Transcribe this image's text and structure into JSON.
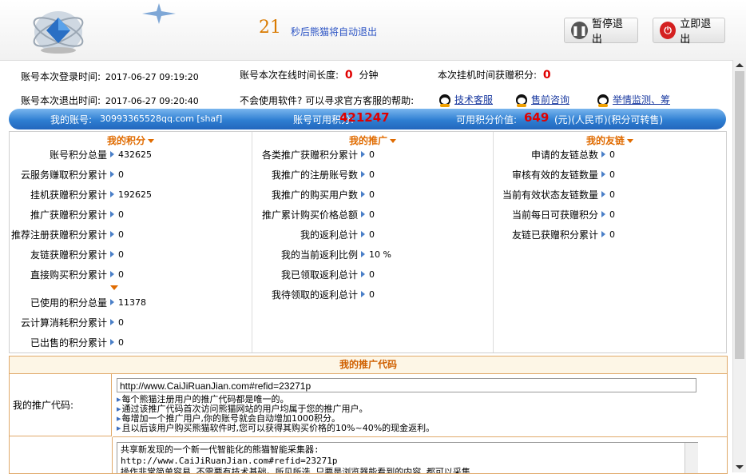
{
  "header": {
    "countdown_number": "21",
    "countdown_text": "秒后熊猫将自动退出",
    "pause_button": "暂停退出",
    "quit_button": "立即退出"
  },
  "info": {
    "login_time_label": "账号本次登录时间:",
    "login_time": "2017-06-27 09:19:20",
    "online_label": "账号本次在线时间长度:",
    "online_value": "0",
    "online_unit": "分钟",
    "earned_label": "本次挂机时间获赠积分:",
    "earned_value": "0",
    "logout_time_label": "账号本次退出时间:",
    "logout_time": "2017-06-27 09:20:40",
    "help_text": "不会使用软件? 可以寻求官方客服的帮助:",
    "links": [
      "技术客服",
      "售前咨询",
      "举情监测、筹"
    ]
  },
  "account_bar": {
    "account_label": "我的账号:",
    "account_value": "30993365528qq.com [shaf]",
    "points_label": "账号可用积分:",
    "points_value": "421247",
    "worth_label": "可用积分价值:",
    "worth_value": "649",
    "worth_unit": "(元)(人民币)(积分可转售)"
  },
  "my_points": {
    "title": "我的积分",
    "rows": [
      {
        "label": "账号积分总量",
        "value": "432625"
      },
      {
        "label": "云服务赚取积分累计",
        "value": "0"
      },
      {
        "label": "挂机获赠积分累计",
        "value": "192625"
      },
      {
        "label": "推广获赠积分累计",
        "value": "0"
      },
      {
        "label": "推荐注册获赠积分累计",
        "value": "0"
      },
      {
        "label": "友链获赠积分累计",
        "value": "0"
      },
      {
        "label": "直接购买积分累计",
        "value": "0"
      },
      {
        "label": "已使用的积分总量",
        "value": "11378"
      },
      {
        "label": "云计算消耗积分累计",
        "value": "0"
      },
      {
        "label": "已出售的积分累计",
        "value": "0"
      }
    ]
  },
  "my_promo": {
    "title": "我的推广",
    "rows": [
      {
        "label": "各类推广获赠积分累计",
        "value": "0"
      },
      {
        "label": "我推广的注册账号数",
        "value": "0"
      },
      {
        "label": "我推广的购买用户数",
        "value": "0"
      },
      {
        "label": "推广累计购买价格总额",
        "value": "0"
      },
      {
        "label": "我的返利总计",
        "value": "0"
      },
      {
        "label": "我的当前返利比例",
        "value": "10 %"
      },
      {
        "label": "我已领取返利总计",
        "value": "0"
      },
      {
        "label": "我待领取的返利总计",
        "value": "0"
      }
    ]
  },
  "my_links": {
    "title": "我的友链",
    "rows": [
      {
        "label": "申请的友链总数",
        "value": "0"
      },
      {
        "label": "审核有效的友链数量",
        "value": "0"
      },
      {
        "label": "当前有效状态友链数量",
        "value": "0"
      },
      {
        "label": "当前每日可获赠积分",
        "value": "0"
      },
      {
        "label": "友链已获赠积分累计",
        "value": "0"
      }
    ]
  },
  "promo_code": {
    "title": "我的推广代码",
    "label": "我的推广代码:",
    "url": "http://www.CaiJiRuanJian.com#refid=23271p",
    "notes": [
      "每个熊猫注册用户的推广代码都是唯一的。",
      "通过该推广代码首次访问熊猫网站的用户均属于您的推广用户。",
      "每增加一个推广用户,你的账号就会自动增加1000积分。",
      "且以后该用户购买熊猫软件时,您可以获得其购买价格的10%~40%的现金返利。"
    ],
    "share_lines": [
      "共享新发现的一个新一代智能化的熊猫智能采集器:",
      "http://www.CaiJiRuanJian.com#refid=23271p",
      "操作非常简单容易,不需要有技术基础。所见所选,只要是浏览器能看到的内容,都可以采集"
    ]
  }
}
